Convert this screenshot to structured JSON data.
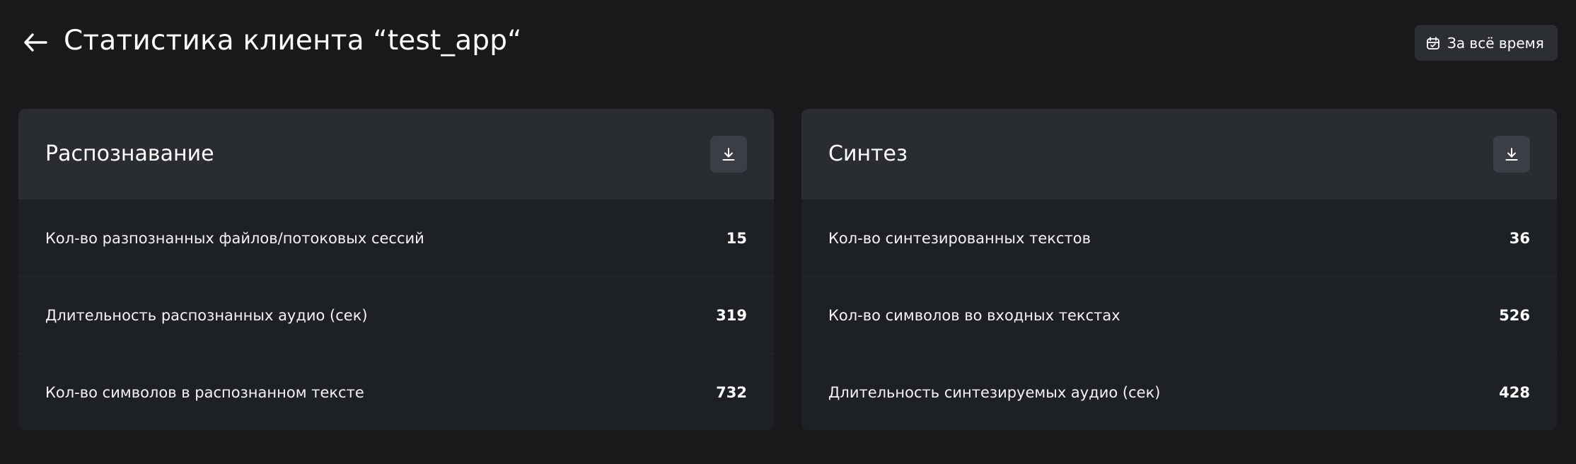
{
  "header": {
    "title": "Статистика клиента “test_app“",
    "back_icon": "arrow-left-icon",
    "period_button": {
      "label": "За всё время",
      "icon": "calendar-icon"
    }
  },
  "cards": [
    {
      "title": "Распознавание",
      "download_icon": "download-icon",
      "rows": [
        {
          "label": "Кол-во разпознанных файлов/потоковых сессий",
          "value": "15"
        },
        {
          "label": "Длительность распознанных аудио (сек)",
          "value": "319"
        },
        {
          "label": "Кол-во символов в распознанном тексте",
          "value": "732"
        }
      ]
    },
    {
      "title": "Синтез",
      "download_icon": "download-icon",
      "rows": [
        {
          "label": "Кол-во синтезированных текстов",
          "value": "36"
        },
        {
          "label": "Кол-во символов во входных текстах",
          "value": "526"
        },
        {
          "label": "Длительность синтезируемых аудио (сек)",
          "value": "428"
        }
      ]
    }
  ],
  "colors": {
    "background": "#18191b",
    "card": "#1e2124",
    "card_header": "#292c31",
    "button": "#3b3f45",
    "text": "#ffffff"
  }
}
